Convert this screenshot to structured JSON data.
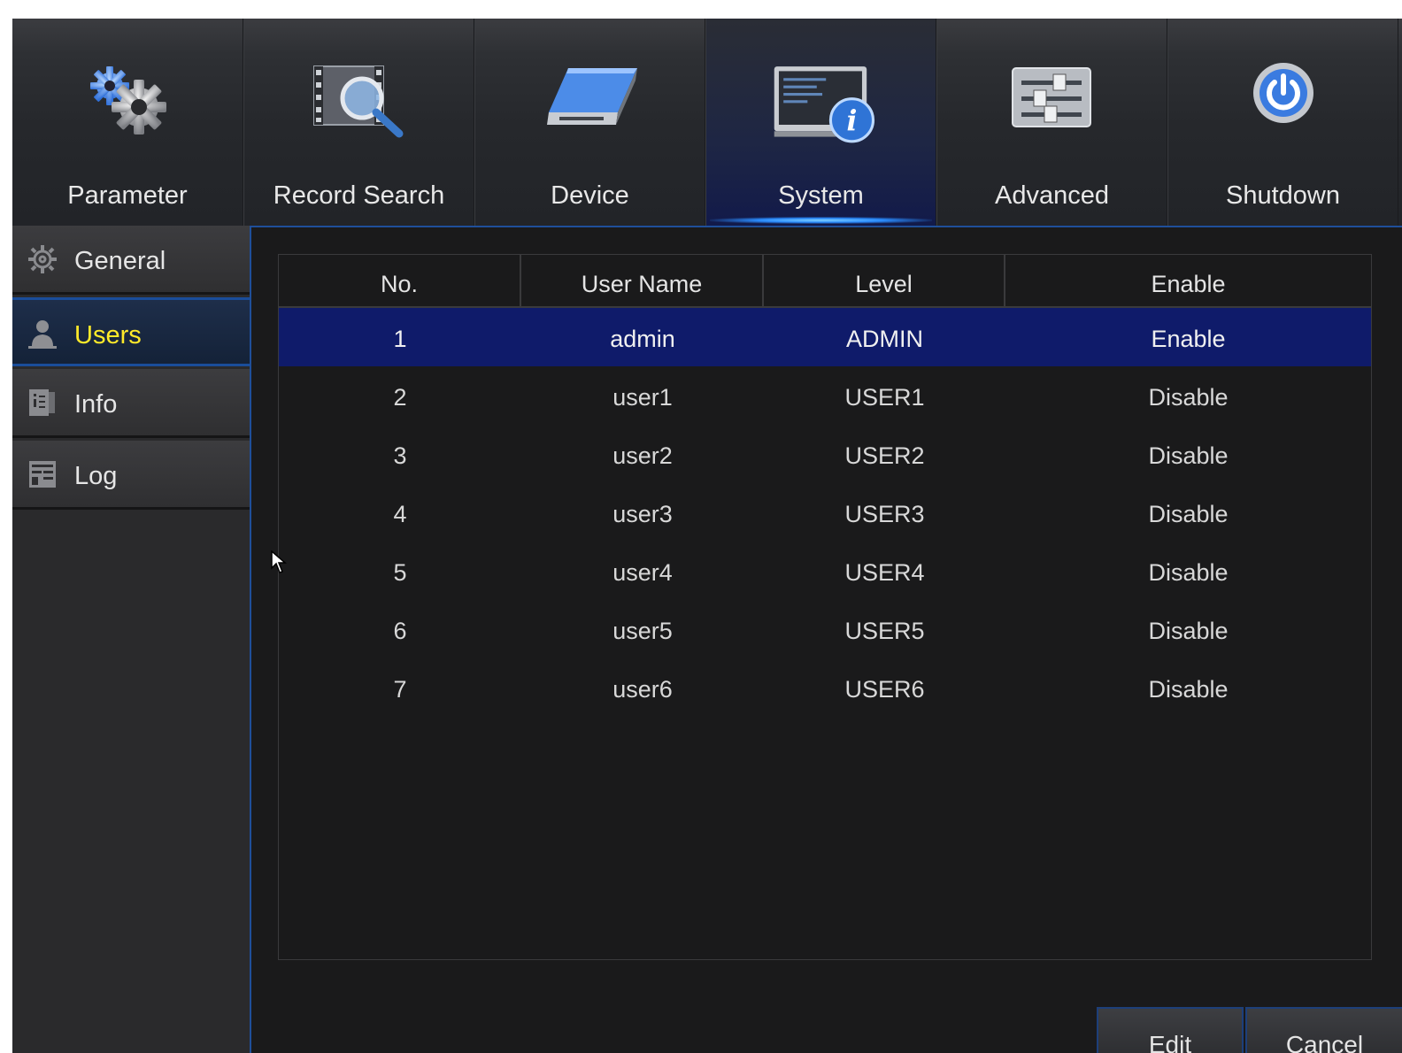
{
  "nav": {
    "tabs": [
      {
        "label": "Parameter",
        "icon": "gears-icon"
      },
      {
        "label": "Record Search",
        "icon": "film-magnifier-icon"
      },
      {
        "label": "Device",
        "icon": "hard-drive-icon"
      },
      {
        "label": "System",
        "icon": "monitor-info-icon",
        "active": true
      },
      {
        "label": "Advanced",
        "icon": "sliders-icon"
      },
      {
        "label": "Shutdown",
        "icon": "power-icon"
      }
    ]
  },
  "sidebar": {
    "items": [
      {
        "label": "General",
        "icon": "gear-icon"
      },
      {
        "label": "Users",
        "icon": "user-icon",
        "active": true
      },
      {
        "label": "Info",
        "icon": "info-icon"
      },
      {
        "label": "Log",
        "icon": "log-icon"
      }
    ]
  },
  "table": {
    "headers": [
      "No.",
      "User Name",
      "Level",
      "Enable"
    ],
    "rows": [
      [
        "1",
        "admin",
        "ADMIN",
        "Enable"
      ],
      [
        "2",
        "user1",
        "USER1",
        "Disable"
      ],
      [
        "3",
        "user2",
        "USER2",
        "Disable"
      ],
      [
        "4",
        "user3",
        "USER3",
        "Disable"
      ],
      [
        "5",
        "user4",
        "USER4",
        "Disable"
      ],
      [
        "6",
        "user5",
        "USER5",
        "Disable"
      ],
      [
        "7",
        "user6",
        "USER6",
        "Disable"
      ]
    ],
    "selected_row": 0
  },
  "buttons": {
    "edit_label": "Edit",
    "cancel_label": "Cancel"
  },
  "colors": {
    "active_text": "#ffea2a",
    "selection": "#0f1b6a",
    "accent_blue": "#1f4f9a"
  }
}
